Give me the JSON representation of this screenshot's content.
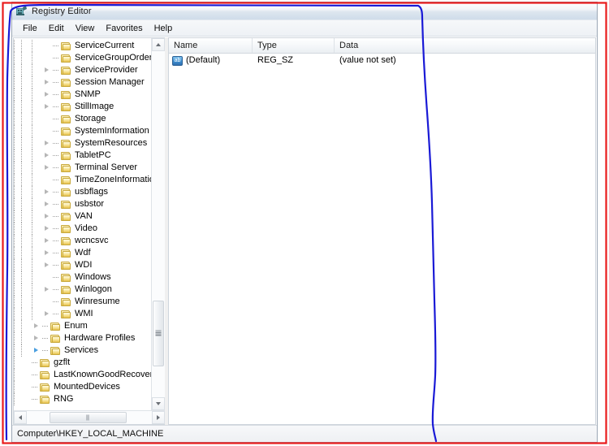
{
  "window": {
    "title": "Registry Editor",
    "icon": "registry-editor-icon"
  },
  "menubar": {
    "items": [
      {
        "label": "File"
      },
      {
        "label": "Edit"
      },
      {
        "label": "View"
      },
      {
        "label": "Favorites"
      },
      {
        "label": "Help"
      }
    ]
  },
  "tree": {
    "items": [
      {
        "label": "ServiceCurrent",
        "indent": 3,
        "expander": "none",
        "tick": true
      },
      {
        "label": "ServiceGroupOrder",
        "indent": 3,
        "expander": "none",
        "tick": true
      },
      {
        "label": "ServiceProvider",
        "indent": 3,
        "expander": "collapsed",
        "tick": true
      },
      {
        "label": "Session Manager",
        "indent": 3,
        "expander": "collapsed",
        "tick": true
      },
      {
        "label": "SNMP",
        "indent": 3,
        "expander": "collapsed",
        "tick": true
      },
      {
        "label": "StillImage",
        "indent": 3,
        "expander": "collapsed",
        "tick": true
      },
      {
        "label": "Storage",
        "indent": 3,
        "expander": "none",
        "tick": true
      },
      {
        "label": "SystemInformation",
        "indent": 3,
        "expander": "none",
        "tick": true
      },
      {
        "label": "SystemResources",
        "indent": 3,
        "expander": "collapsed",
        "tick": true
      },
      {
        "label": "TabletPC",
        "indent": 3,
        "expander": "collapsed",
        "tick": true
      },
      {
        "label": "Terminal Server",
        "indent": 3,
        "expander": "collapsed",
        "tick": true
      },
      {
        "label": "TimeZoneInformation",
        "indent": 3,
        "expander": "none",
        "tick": true
      },
      {
        "label": "usbflags",
        "indent": 3,
        "expander": "collapsed",
        "tick": true
      },
      {
        "label": "usbstor",
        "indent": 3,
        "expander": "collapsed",
        "tick": true
      },
      {
        "label": "VAN",
        "indent": 3,
        "expander": "collapsed",
        "tick": true
      },
      {
        "label": "Video",
        "indent": 3,
        "expander": "collapsed",
        "tick": true
      },
      {
        "label": "wcncsvc",
        "indent": 3,
        "expander": "collapsed",
        "tick": true
      },
      {
        "label": "Wdf",
        "indent": 3,
        "expander": "collapsed",
        "tick": true
      },
      {
        "label": "WDI",
        "indent": 3,
        "expander": "collapsed",
        "tick": true
      },
      {
        "label": "Windows",
        "indent": 3,
        "expander": "none",
        "tick": true
      },
      {
        "label": "Winlogon",
        "indent": 3,
        "expander": "collapsed",
        "tick": true
      },
      {
        "label": "Winresume",
        "indent": 3,
        "expander": "none",
        "tick": true
      },
      {
        "label": "WMI",
        "indent": 3,
        "expander": "collapsed",
        "tick": true
      },
      {
        "label": "Enum",
        "indent": 2,
        "expander": "collapsed",
        "tick": true
      },
      {
        "label": "Hardware Profiles",
        "indent": 2,
        "expander": "collapsed",
        "tick": true
      },
      {
        "label": "Services",
        "indent": 2,
        "expander": "collapsed-highlight",
        "tick": true
      },
      {
        "label": "gzflt",
        "indent": 1,
        "expander": "none",
        "tick": true
      },
      {
        "label": "LastKnownGoodRecovery",
        "indent": 1,
        "expander": "none",
        "tick": true
      },
      {
        "label": "MountedDevices",
        "indent": 1,
        "expander": "none",
        "tick": true
      },
      {
        "label": "RNG",
        "indent": 1,
        "expander": "none",
        "tick": true
      }
    ]
  },
  "list": {
    "columns": [
      {
        "label": "Name"
      },
      {
        "label": "Type"
      },
      {
        "label": "Data"
      }
    ],
    "rows": [
      {
        "icon": "string-value-icon",
        "icon_text": "ab",
        "name": "(Default)",
        "type": "REG_SZ",
        "data": "(value not set)"
      }
    ]
  },
  "statusbar": {
    "path": "Computer\\HKEY_LOCAL_MACHINE"
  },
  "annotations": {
    "outer_rect_color": "#e81b1b",
    "inner_path_color": "#1a1ad6"
  }
}
